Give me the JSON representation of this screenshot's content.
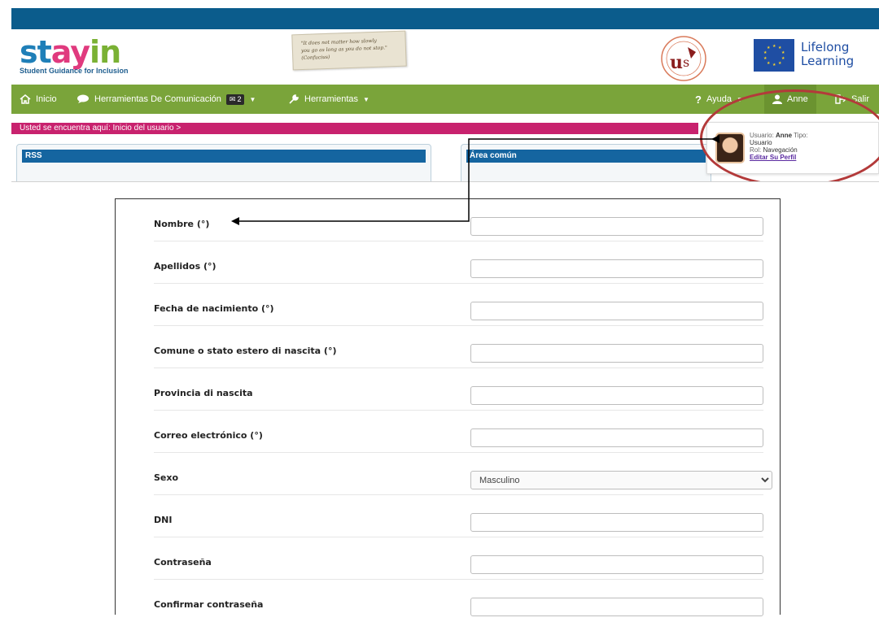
{
  "logo": {
    "part1": "st",
    "part2": "ay",
    "part3": "in",
    "subtitle": "Student Guidance for Inclusion"
  },
  "quote": {
    "line1": "\"It does not matter how slowly",
    "line2": "you go as long as you do not stop.\" (Confucius)"
  },
  "partner": {
    "eu_label_1": "Lifelong",
    "eu_label_2": "Learning"
  },
  "nav": {
    "inicio": "Inicio",
    "comunicacion": "Herramientas De Comunicación",
    "mail_count": "2",
    "herramientas": "Herramientas",
    "ayuda": "Ayuda",
    "user": "Anne",
    "salir": "Salir"
  },
  "breadcrumb": "Usted se encuentra aquí: Inicio del usuario >",
  "panels": {
    "rss": "RSS",
    "area": "Área común"
  },
  "profile": {
    "usuario_label": "Usuario:",
    "usuario_value": "Anne",
    "tipo_label": "Tipo:",
    "tipo_value": "Usuario",
    "rol_label": "Rol:",
    "rol_value": "Navegación",
    "edit_link": "Editar Su Perfil"
  },
  "form": {
    "fields": [
      {
        "label": "Nombre (°)",
        "value": ""
      },
      {
        "label": "Apellidos (°)",
        "value": ""
      },
      {
        "label": "Fecha de nacimiento (°)",
        "value": ""
      },
      {
        "label": "Comune o stato estero di nascita (°)",
        "value": ""
      },
      {
        "label": "Provincia di nascita",
        "value": ""
      },
      {
        "label": "Correo electrónico (°)",
        "value": ""
      },
      {
        "label": "Sexo",
        "value": "Masculino"
      },
      {
        "label": "DNI",
        "value": ""
      },
      {
        "label": "Contraseña",
        "value": ""
      },
      {
        "label": "Confirmar contraseña",
        "value": ""
      }
    ],
    "sexo_options": [
      "Masculino"
    ]
  },
  "colors": {
    "topband": "#0b5c8c",
    "navbar": "#7aa43a",
    "breadcrumb": "#c8226e",
    "panel_head": "#1565a0",
    "highlight": "#b33a3a"
  }
}
